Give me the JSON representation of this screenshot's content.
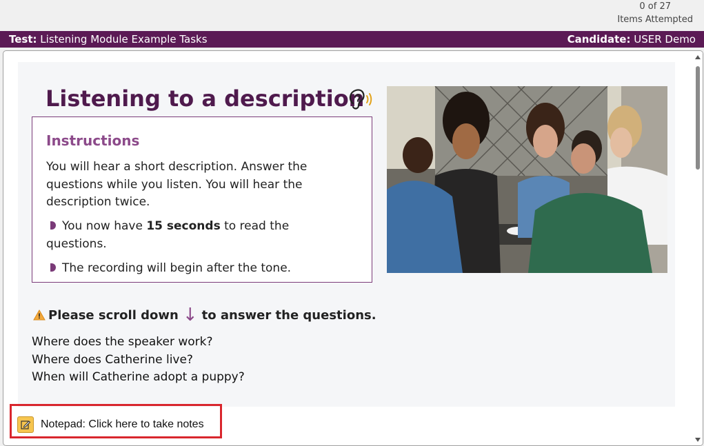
{
  "header": {
    "progress_count": "0 of 27",
    "progress_label": "Items Attempted"
  },
  "testbar": {
    "test_label": "Test:",
    "test_name": "Listening Module Example Tasks",
    "candidate_label": "Candidate:",
    "candidate_name": "USER Demo"
  },
  "content": {
    "title": "Listening to a description",
    "instructions": {
      "heading": "Instructions",
      "paragraph": "You will hear a short description. Answer the questions while you listen. You will hear the description twice.",
      "bullet1_pre": "You now have ",
      "bullet1_bold": "15 seconds",
      "bullet1_post": " to read the questions.",
      "bullet2": "The recording will begin after the tone."
    },
    "scroll_note_pre": "Please scroll down",
    "scroll_note_post": "to answer the questions.",
    "questions": [
      "Where does the speaker work?",
      "Where does Catherine live?",
      "When will Catherine adopt a puppy?"
    ]
  },
  "notepad": {
    "label": "Notepad: Click here to take notes"
  },
  "colors": {
    "brand_purple": "#5b1a55",
    "title_purple": "#4f1a4d",
    "highlight_red": "#d9262d"
  }
}
